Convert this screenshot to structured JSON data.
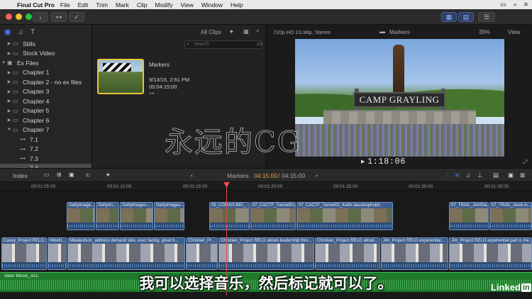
{
  "menubar": {
    "app_name": "Final Cut Pro",
    "items": [
      "File",
      "Edit",
      "Trim",
      "Mark",
      "Clip",
      "Modify",
      "View",
      "Window",
      "Help"
    ]
  },
  "sidebar": {
    "items": [
      {
        "label": "Stills",
        "level": 1
      },
      {
        "label": "Stock Video",
        "level": 1
      },
      {
        "label": "Ex Files",
        "level": 0,
        "expanded": true
      },
      {
        "label": "Chapter 1",
        "level": 1
      },
      {
        "label": "Chapter 2 - no ex files",
        "level": 1
      },
      {
        "label": "Chapter 3",
        "level": 1
      },
      {
        "label": "Chapter 4",
        "level": 1
      },
      {
        "label": "Chapter 5",
        "level": 1
      },
      {
        "label": "Chapter 6",
        "level": 1
      },
      {
        "label": "Chapter 7",
        "level": 1,
        "expanded": true
      },
      {
        "label": "7.1",
        "level": 2
      },
      {
        "label": "7.2",
        "level": 2
      },
      {
        "label": "7.3",
        "level": 2
      },
      {
        "label": "7.4",
        "level": 2,
        "selected": true
      }
    ]
  },
  "browser": {
    "filter": "All Clips",
    "search_placeholder": "Search",
    "clip": {
      "name": "Markers",
      "date": "9/13/16, 2:51 PM",
      "duration": "00:04:15:00"
    }
  },
  "viewer": {
    "format": "720p HD 23.98p, Stereo",
    "title": "Markers",
    "zoom": "39%",
    "view_menu": "View",
    "sign_text": "CAMP GRAYLING",
    "timecode": "1:18:06"
  },
  "watermark": "永远的CG",
  "timeline": {
    "index_label": "Index",
    "project_name": "Markers",
    "position": "04:15:00",
    "duration": "04:15:00",
    "ruler": [
      "00:01:05:00",
      "00:01:10:00",
      "00:01:15:00",
      "00:01:20:00",
      "00:01:25:00",
      "00:01:30:00",
      "00:01:35:00"
    ],
    "connected_clips": [
      "GettyImage...",
      "GettyIm...",
      "GettyImages-...",
      "GettyImages-...",
      "05_CGRAYLING_...",
      "07_CACTF_TunnelEn...",
      "07_CACTF_Tunnel01_Keith claustrophobic",
      "07_TRAIL_JimSha...",
      "07_TRAIL_stuck in..."
    ],
    "primary_clips": [
      "Casey_Project RELO...",
      "MikeN...",
      "Mikeleutson_address demand side, exec facing, great b...",
      "Christian_Pr...",
      "Christian_Project RELO allows leadership thro...",
      "Christian_Project RELO allowi...",
      "Jim_Project RELO experiential...",
      "Jim_Project RELO experiential part is me..."
    ],
    "music": "Valor Music_ALL"
  },
  "subtitle": "我可以选择音乐，然后标记就可以了。",
  "brand": {
    "name": "Linked",
    "in": "in"
  },
  "colors": {
    "accent": "#4f7dff",
    "playhead": "#e84a4a",
    "music": "#1f7a2c",
    "selection": "#e8c43a"
  }
}
